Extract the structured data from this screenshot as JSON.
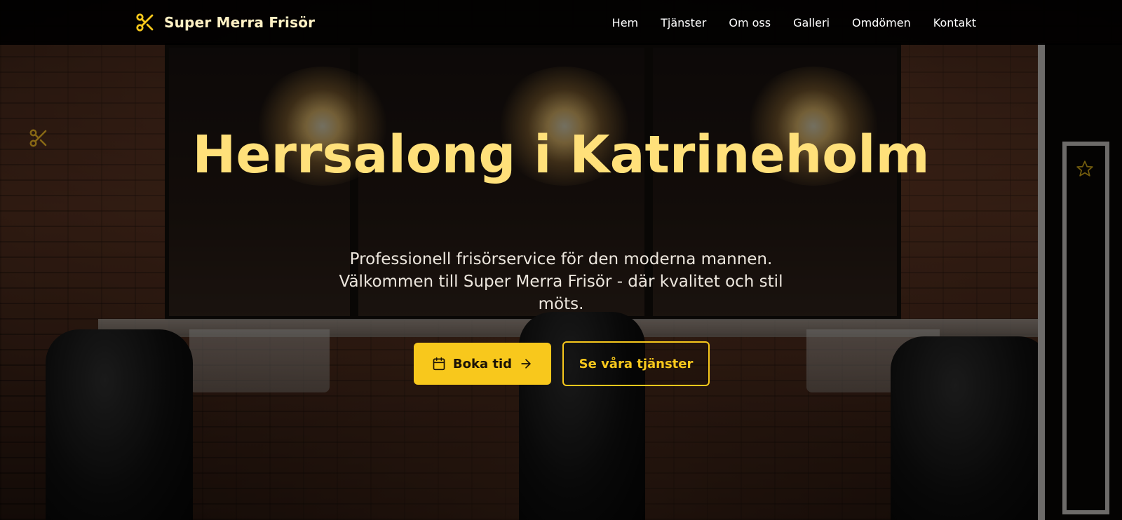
{
  "nav": {
    "brand_name": "Super Merra Frisör",
    "links": [
      "Hem",
      "Tjänster",
      "Om oss",
      "Galleri",
      "Omdömen",
      "Kontakt"
    ]
  },
  "hero": {
    "title": "Herrsalong i Katrineholm",
    "subtitle": "Professionell frisörservice för den moderna mannen. Välkommen till Super Merra Frisör - där kvalitet och stil möts.",
    "primary_cta": "Boka tid",
    "secondary_cta": "Se våra tjänster"
  },
  "icons": {
    "brand": "scissors-icon",
    "primary_cta_leading": "calendar-icon",
    "primary_cta_trailing": "arrow-right-icon",
    "decorative_left": "scissors-icon",
    "decorative_right": "star-icon"
  },
  "colors": {
    "accent": "#f8c81c",
    "title": "#ffe07a",
    "brand_text": "#fff1c4",
    "navbar_bg": "#000000"
  }
}
